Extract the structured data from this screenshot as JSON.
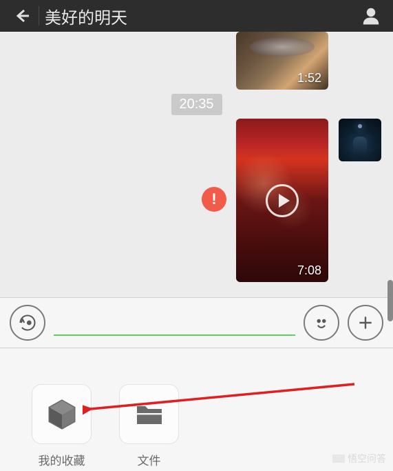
{
  "header": {
    "title": "美好的明天",
    "back_icon": "back-arrow-icon",
    "person_icon": "person-icon"
  },
  "chat": {
    "timestamp": "20:35",
    "video1_duration": "1:52",
    "video2_duration": "7:08",
    "error_symbol": "!"
  },
  "input": {
    "voice_icon": "voice-icon",
    "emoji_icon": "smiley-icon",
    "plus_icon": "plus-icon",
    "placeholder": ""
  },
  "attachments": {
    "favorites": {
      "label": "我的收藏",
      "icon": "cube-icon"
    },
    "files": {
      "label": "文件",
      "icon": "folder-icon"
    }
  },
  "watermark": "悟空问答"
}
